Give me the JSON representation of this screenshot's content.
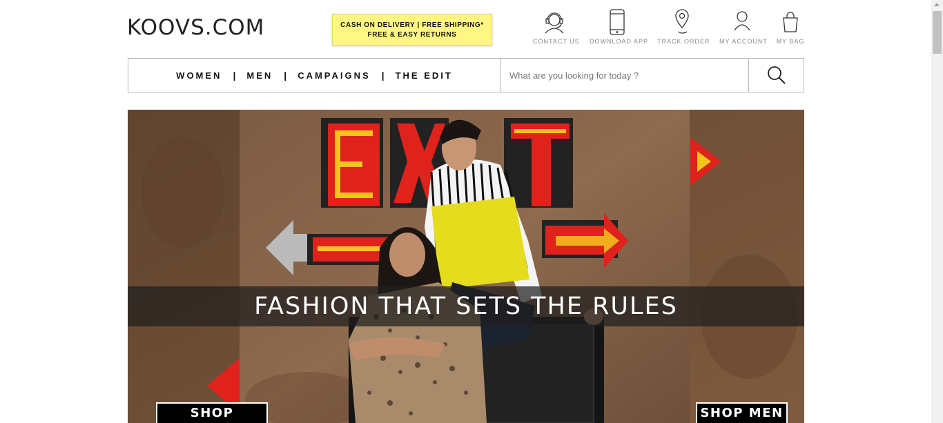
{
  "brand": {
    "logo": "KOOVS.COM"
  },
  "promo": {
    "line1": "CASH ON DELIVERY | FREE SHIPPING*",
    "line2": "FREE & EASY RETURNS",
    "color": "#fff684"
  },
  "utilities": [
    {
      "label": "CONTACT US",
      "icon": "headset-icon"
    },
    {
      "label": "DOWNLOAD APP",
      "icon": "mobile-phone-icon"
    },
    {
      "label": "TRACK ORDER",
      "icon": "location-pin-icon"
    },
    {
      "label": "MY ACCOUNT",
      "icon": "user-icon"
    },
    {
      "label": "MY BAG",
      "icon": "shopping-bag-icon"
    }
  ],
  "nav": {
    "links": [
      "WOMEN",
      "MEN",
      "CAMPAIGNS",
      "THE EDIT"
    ],
    "separator": "|"
  },
  "search": {
    "placeholder": "What are you looking for today ?",
    "icon": "search-icon"
  },
  "hero": {
    "title": "FASHION THAT SETS THE RULES",
    "shop_women": "SHOP WOMEN",
    "shop_men": "SHOP MEN",
    "sign_text": "EXIT",
    "colors": {
      "wall": "#7a5a40",
      "sign_red": "#e0221d",
      "sign_yellow": "#f2c51c",
      "shirt_yellow": "#e6dc1e"
    }
  }
}
